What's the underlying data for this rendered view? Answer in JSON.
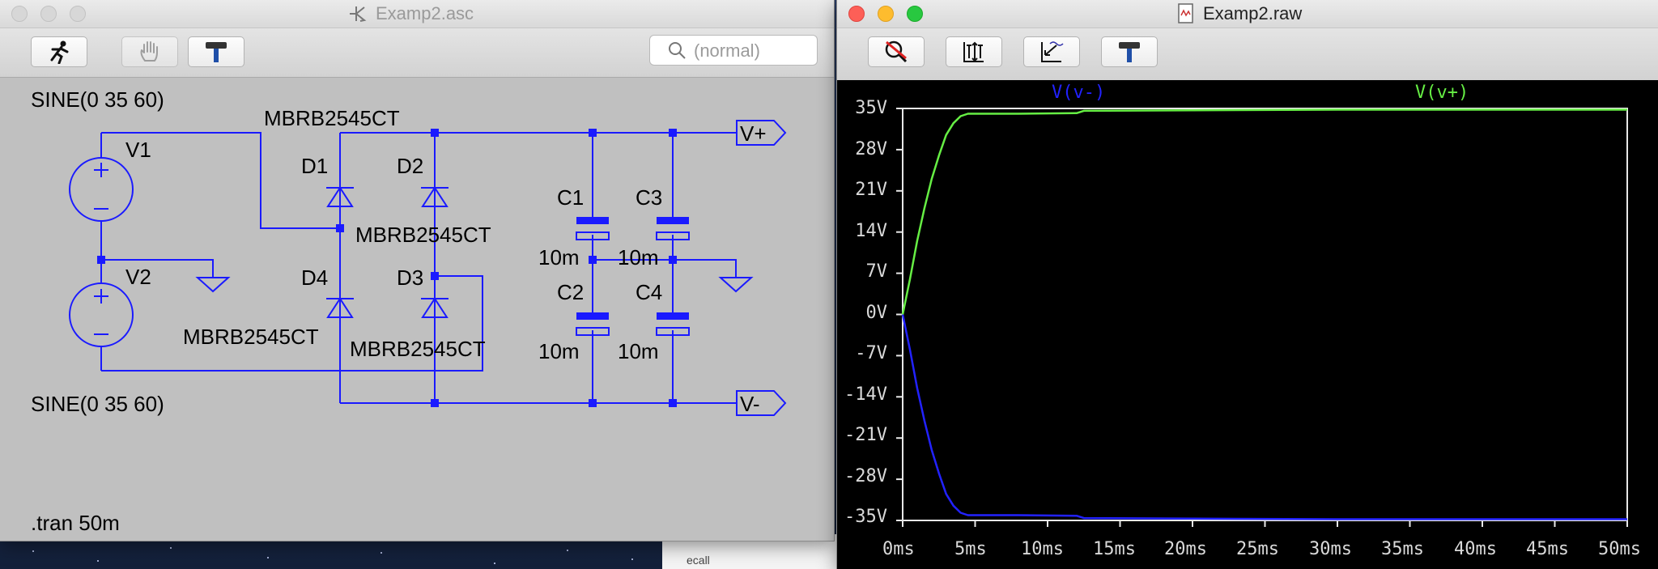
{
  "schematic_window": {
    "title": "Examp2.asc",
    "search": {
      "placeholder": "(normal)"
    },
    "toolbar": {
      "icons": [
        "run-icon",
        "halt-hand-icon",
        "hammer-icon"
      ]
    },
    "source_v1": {
      "name": "V1",
      "value": "SINE(0 35 60)"
    },
    "source_v2": {
      "name": "V2",
      "value": "SINE(0 35 60)"
    },
    "diodes": [
      {
        "name": "D1",
        "part": "MBRB2545CT"
      },
      {
        "name": "D2",
        "part": "MBRB2545CT"
      },
      {
        "name": "D3",
        "part": "MBRB2545CT"
      },
      {
        "name": "D4",
        "part": "MBRB2545CT"
      }
    ],
    "capacitors": [
      {
        "name": "C1",
        "value": "10m"
      },
      {
        "name": "C2",
        "value": "10m"
      },
      {
        "name": "C3",
        "value": "10m"
      },
      {
        "name": "C4",
        "value": "10m"
      }
    ],
    "ports": {
      "vplus": "V+",
      "vminus": "V-"
    },
    "directive": ".tran 50m"
  },
  "waveform_window": {
    "title": "Examp2.raw",
    "toolbar": {
      "icons": [
        "zoom-cancel-icon",
        "autorange-icon",
        "zoom-extents-icon",
        "hammer-icon"
      ]
    },
    "chart_data": {
      "type": "line",
      "x_label_ticks": [
        "0ms",
        "5ms",
        "10ms",
        "15ms",
        "20ms",
        "25ms",
        "30ms",
        "35ms",
        "40ms",
        "45ms",
        "50ms"
      ],
      "y_label_ticks": [
        "35V",
        "28V",
        "21V",
        "14V",
        "7V",
        "0V",
        "-7V",
        "-14V",
        "-21V",
        "-28V",
        "-35V"
      ],
      "xlim": [
        0,
        50
      ],
      "ylim": [
        -35,
        35
      ],
      "series": [
        {
          "name": "V(v-)",
          "color": "#2222ff",
          "x": [
            0,
            0.5,
            1,
            1.5,
            2,
            2.5,
            3,
            3.5,
            4,
            4.5,
            5,
            8,
            12,
            12.5,
            20,
            30,
            40,
            50
          ],
          "y": [
            0,
            -6,
            -12.5,
            -18,
            -23,
            -27,
            -30.5,
            -32.5,
            -33.7,
            -34.1,
            -34.1,
            -34.1,
            -34.2,
            -34.6,
            -34.7,
            -34.8,
            -34.8,
            -34.8
          ]
        },
        {
          "name": "V(v+)",
          "color": "#66ee44",
          "x": [
            0,
            0.5,
            1,
            1.5,
            2,
            2.5,
            3,
            3.5,
            4,
            4.5,
            5,
            8,
            12,
            12.5,
            20,
            30,
            40,
            50
          ],
          "y": [
            0,
            6,
            12.5,
            18,
            23,
            27,
            30.5,
            32.5,
            33.7,
            34.1,
            34.1,
            34.1,
            34.2,
            34.6,
            34.7,
            34.8,
            34.8,
            34.8
          ]
        }
      ]
    }
  },
  "background": {
    "doc_fragment": "ecall"
  }
}
